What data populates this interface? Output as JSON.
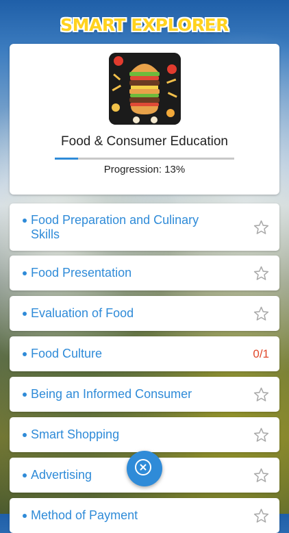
{
  "app": {
    "logo_text": "SMART EXPLORER"
  },
  "course": {
    "title": "Food & Consumer Education",
    "progress_fraction": 0.13,
    "progress_text": "Progression: 13%",
    "thumbnail_icon": "burger-icon"
  },
  "topics": [
    {
      "label": "Food Preparation and Culinary Skills",
      "status": "star"
    },
    {
      "label": "Food Presentation",
      "status": "star"
    },
    {
      "label": "Evaluation of Food",
      "status": "star"
    },
    {
      "label": "Food Culture",
      "status": "score",
      "score": "0/1"
    },
    {
      "label": "Being an Informed Consumer",
      "status": "star"
    },
    {
      "label": "Smart Shopping",
      "status": "star"
    },
    {
      "label": "Advertising",
      "status": "star"
    },
    {
      "label": "Method of Payment",
      "status": "star"
    }
  ],
  "colors": {
    "accent": "#2f8bd8",
    "score": "#e0482a",
    "logo": "#ffd21f"
  },
  "fab": {
    "icon": "close-icon"
  }
}
